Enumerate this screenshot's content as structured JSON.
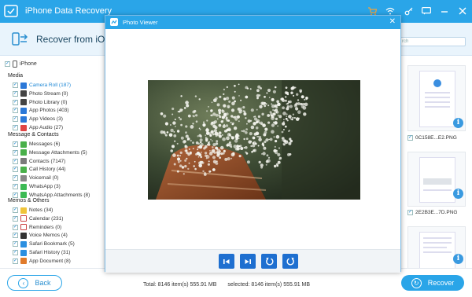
{
  "app": {
    "title": "iPhone Data Recovery"
  },
  "header": {
    "title": "Recover from iOS D"
  },
  "search": {
    "placeholder": "rch"
  },
  "sidebar": {
    "root_label": "iPhone",
    "sections": [
      {
        "title": "Media",
        "items": [
          {
            "label": "Camera Roll (187)",
            "icon": "camera-roll-icon",
            "color": "#2b78d8",
            "active": true
          },
          {
            "label": "Photo Stream (0)",
            "icon": "photo-stream-icon",
            "color": "#444"
          },
          {
            "label": "Photo Library (0)",
            "icon": "photo-library-icon",
            "color": "#444"
          },
          {
            "label": "App Photos (403)",
            "icon": "app-photos-icon",
            "color": "#2b78d8"
          },
          {
            "label": "App Videos (3)",
            "icon": "app-videos-icon",
            "color": "#2b78d8"
          },
          {
            "label": "App Audio (27)",
            "icon": "app-audio-icon",
            "color": "#e04545"
          }
        ]
      },
      {
        "title": "Message & Contacts",
        "items": [
          {
            "label": "Messages (6)",
            "icon": "messages-icon",
            "color": "#49b04a"
          },
          {
            "label": "Message Attachments (5)",
            "icon": "message-attachments-icon",
            "color": "#49b04a"
          },
          {
            "label": "Contacts (7147)",
            "icon": "contacts-icon",
            "color": "#7a7a7a"
          },
          {
            "label": "Call History (44)",
            "icon": "call-history-icon",
            "color": "#49b04a"
          },
          {
            "label": "Voicemail (0)",
            "icon": "voicemail-icon",
            "color": "#888"
          },
          {
            "label": "WhatsApp (3)",
            "icon": "whatsapp-icon",
            "color": "#3cba54"
          },
          {
            "label": "WhatsApp Attachments (8)",
            "icon": "whatsapp-attachments-icon",
            "color": "#3cba54"
          }
        ]
      },
      {
        "title": "Memos & Others",
        "items": [
          {
            "label": "Notes (34)",
            "icon": "notes-icon",
            "color": "#f0c43a"
          },
          {
            "label": "Calendar (231)",
            "icon": "calendar-icon",
            "color": "#ffffff"
          },
          {
            "label": "Reminders (0)",
            "icon": "reminders-icon",
            "color": "#ffffff"
          },
          {
            "label": "Voice Memos (4)",
            "icon": "voice-memos-icon",
            "color": "#333"
          },
          {
            "label": "Safari Bookmark (5)",
            "icon": "safari-bookmark-icon",
            "color": "#2b8fe0"
          },
          {
            "label": "Safari History (31)",
            "icon": "safari-history-icon",
            "color": "#2b8fe0"
          },
          {
            "label": "App Document (8)",
            "icon": "app-document-icon",
            "color": "#e07b2b"
          }
        ]
      }
    ]
  },
  "thumbnails": [
    {
      "label": "0C158E...E2.PNG"
    },
    {
      "label": "2E2B3E...7D.PNG"
    },
    {
      "label": ""
    }
  ],
  "modal": {
    "title": "Photo Viewer",
    "controls": [
      "first-icon",
      "next-icon",
      "rotate-left-icon",
      "rotate-right-icon"
    ]
  },
  "footer": {
    "back_label": "Back",
    "total_text": "Total: 8146 item(s) 555.91 MB",
    "selected_text": "selected: 8146 item(s) 555.91 MB",
    "recover_label": "Recover"
  },
  "colors": {
    "accent": "#2aa5e8",
    "button_dark": "#1e6fd0"
  }
}
